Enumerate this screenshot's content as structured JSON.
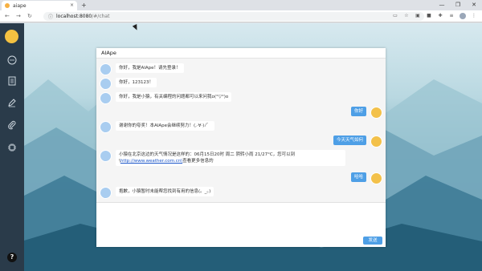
{
  "browser": {
    "tab_title": "aiape",
    "tab_close": "×",
    "new_tab": "+",
    "url_host": "localhost:8080",
    "url_path": "/#/chat",
    "window_buttons": [
      "—",
      "❐",
      "✕"
    ]
  },
  "chat": {
    "title": "AIApe",
    "send_label": "发送",
    "messages": [
      {
        "from": "bot",
        "text": "你好，我是AIApe！请先登录！"
      },
      {
        "from": "bot",
        "text": "你好，123123！"
      },
      {
        "from": "bot",
        "text": "你好，我是小猿，有关编程的问题都可以来问我o(°▽°)o"
      },
      {
        "from": "user",
        "text": "你好"
      },
      {
        "from": "bot",
        "text": "谢谢你的夸奖！本AIApe会继续努力！(,·∀·)ﾉ゛"
      },
      {
        "from": "user",
        "text": "今天天气如何"
      },
      {
        "from": "bot",
        "text_line1": "小猿在北京这边的天气情况是这样的：06月15日20时 周二 阴转小雨 21/27°C，您可以到",
        "text_prefix": "\\",
        "link": "http://www.weather.com.cn\\",
        "text_suffix": "查看更多信息的"
      },
      {
        "from": "user",
        "text": "哈哈"
      },
      {
        "from": "bot",
        "text": "抱歉，小猿暂时未能帮您找到有用的信息(。_。)"
      }
    ]
  },
  "sidebar": {
    "icons": [
      "chat-icon",
      "document-icon",
      "edit-icon",
      "clip-icon",
      "chip-icon"
    ],
    "help": "?"
  },
  "colors": {
    "sidebar": "#2a3b4a",
    "user_bubble": "#4e9fe6",
    "send_button": "#4e9fe6"
  }
}
